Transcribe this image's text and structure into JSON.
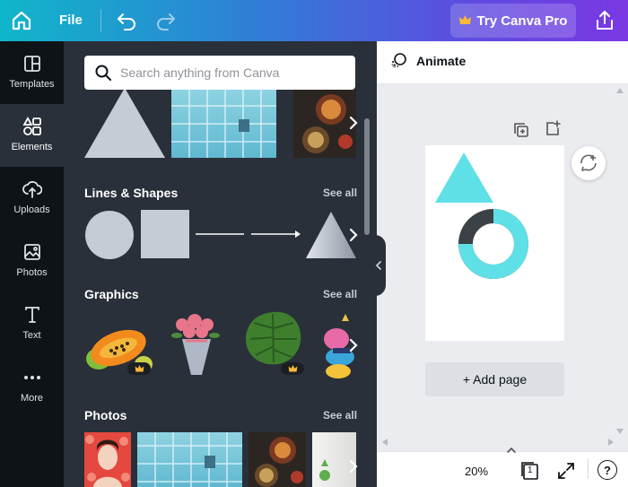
{
  "topbar": {
    "file_label": "File",
    "pro_label": "Try Canva Pro",
    "icons": [
      "home-icon",
      "undo-icon",
      "redo-icon",
      "crown-icon",
      "share-icon"
    ]
  },
  "rail": {
    "items": [
      {
        "label": "Templates",
        "icon": "templates-icon"
      },
      {
        "label": "Elements",
        "icon": "elements-icon"
      },
      {
        "label": "Uploads",
        "icon": "uploads-icon"
      },
      {
        "label": "Photos",
        "icon": "photos-icon"
      },
      {
        "label": "Text",
        "icon": "text-icon"
      },
      {
        "label": "More",
        "icon": "more-icon"
      }
    ],
    "active": "Elements"
  },
  "panel": {
    "search_placeholder": "Search anything from Canva",
    "sections": [
      {
        "title": "Lines & Shapes",
        "see_all": "See all"
      },
      {
        "title": "Graphics",
        "see_all": "See all"
      },
      {
        "title": "Photos",
        "see_all": "See all"
      }
    ]
  },
  "canvas": {
    "animate_label": "Animate",
    "add_page_label": "+ Add page",
    "accent": "#5fe0e6",
    "donut_dark": "#3c4047"
  },
  "bottombar": {
    "zoom": "20%",
    "page_count": "1",
    "help": "?"
  }
}
